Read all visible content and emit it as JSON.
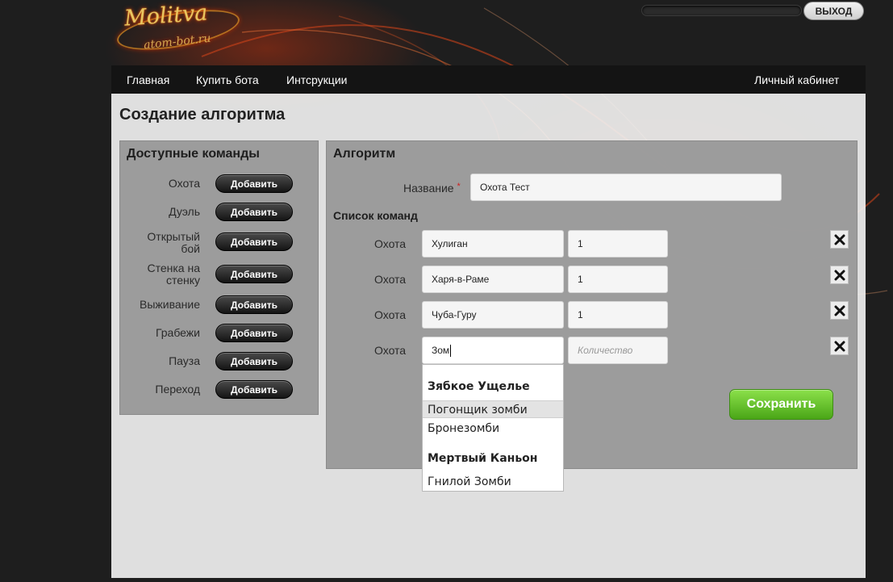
{
  "logo": {
    "line1": "Molitva",
    "line2": "atom-bot.ru"
  },
  "header": {
    "exit_label": "ВЫХОД"
  },
  "nav": {
    "home": "Главная",
    "buy": "Купить бота",
    "instructions": "Интсрукции",
    "cabinet": "Личный кабинет"
  },
  "page": {
    "title": "Создание алгоритма"
  },
  "commands": {
    "title": "Доступные команды",
    "add_label": "Добавить",
    "items": [
      {
        "label_lines": [
          "Охота"
        ]
      },
      {
        "label_lines": [
          "Дуэль"
        ]
      },
      {
        "label_lines": [
          "Открытый",
          "бой"
        ]
      },
      {
        "label_lines": [
          "Стенка на",
          "стенку"
        ]
      },
      {
        "label_lines": [
          "Выживание"
        ]
      },
      {
        "label_lines": [
          "Грабежи"
        ]
      },
      {
        "label_lines": [
          "Пауза"
        ]
      },
      {
        "label_lines": [
          "Переход"
        ]
      }
    ]
  },
  "algorithm": {
    "title": "Алгоритм",
    "name_label": "Название",
    "required_mark": "*",
    "name_value": "Охота Тест",
    "list_title": "Список команд",
    "rows": [
      {
        "type": "Охота",
        "target": "Хулиган",
        "count": "1"
      },
      {
        "type": "Охота",
        "target": "Харя-в-Раме",
        "count": "1"
      },
      {
        "type": "Охота",
        "target": "Чуба-Гуру",
        "count": "1"
      },
      {
        "type": "Охота",
        "target": "Зом",
        "count": ""
      }
    ],
    "count_placeholder": "Количество",
    "save_label": "Сохранить"
  },
  "autocomplete": {
    "groups": [
      {
        "name": "Зябкое Ущелье",
        "options": [
          "Погонщик зомби",
          "Бронезомби"
        ]
      },
      {
        "name": "Мертвый Каньон",
        "options": [
          "Гнилой Зомби"
        ]
      }
    ],
    "highlighted": "Погонщик зомби"
  },
  "colors": {
    "accent_green": "#5bbf24",
    "nav_bg": "#141414",
    "panel_bg": "#969696"
  }
}
